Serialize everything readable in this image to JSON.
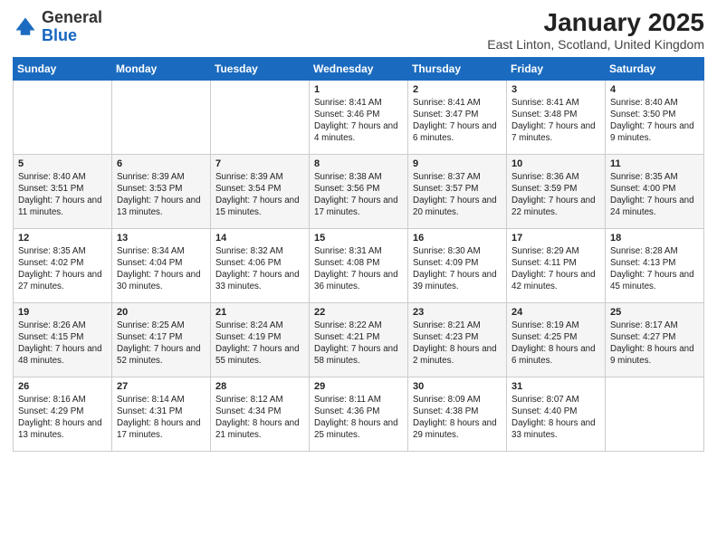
{
  "header": {
    "logo_general": "General",
    "logo_blue": "Blue",
    "title": "January 2025",
    "subtitle": "East Linton, Scotland, United Kingdom"
  },
  "weekdays": [
    "Sunday",
    "Monday",
    "Tuesday",
    "Wednesday",
    "Thursday",
    "Friday",
    "Saturday"
  ],
  "weeks": [
    [
      {
        "day": "",
        "info": ""
      },
      {
        "day": "",
        "info": ""
      },
      {
        "day": "",
        "info": ""
      },
      {
        "day": "1",
        "info": "Sunrise: 8:41 AM\nSunset: 3:46 PM\nDaylight: 7 hours\nand 4 minutes."
      },
      {
        "day": "2",
        "info": "Sunrise: 8:41 AM\nSunset: 3:47 PM\nDaylight: 7 hours\nand 6 minutes."
      },
      {
        "day": "3",
        "info": "Sunrise: 8:41 AM\nSunset: 3:48 PM\nDaylight: 7 hours\nand 7 minutes."
      },
      {
        "day": "4",
        "info": "Sunrise: 8:40 AM\nSunset: 3:50 PM\nDaylight: 7 hours\nand 9 minutes."
      }
    ],
    [
      {
        "day": "5",
        "info": "Sunrise: 8:40 AM\nSunset: 3:51 PM\nDaylight: 7 hours\nand 11 minutes."
      },
      {
        "day": "6",
        "info": "Sunrise: 8:39 AM\nSunset: 3:53 PM\nDaylight: 7 hours\nand 13 minutes."
      },
      {
        "day": "7",
        "info": "Sunrise: 8:39 AM\nSunset: 3:54 PM\nDaylight: 7 hours\nand 15 minutes."
      },
      {
        "day": "8",
        "info": "Sunrise: 8:38 AM\nSunset: 3:56 PM\nDaylight: 7 hours\nand 17 minutes."
      },
      {
        "day": "9",
        "info": "Sunrise: 8:37 AM\nSunset: 3:57 PM\nDaylight: 7 hours\nand 20 minutes."
      },
      {
        "day": "10",
        "info": "Sunrise: 8:36 AM\nSunset: 3:59 PM\nDaylight: 7 hours\nand 22 minutes."
      },
      {
        "day": "11",
        "info": "Sunrise: 8:35 AM\nSunset: 4:00 PM\nDaylight: 7 hours\nand 24 minutes."
      }
    ],
    [
      {
        "day": "12",
        "info": "Sunrise: 8:35 AM\nSunset: 4:02 PM\nDaylight: 7 hours\nand 27 minutes."
      },
      {
        "day": "13",
        "info": "Sunrise: 8:34 AM\nSunset: 4:04 PM\nDaylight: 7 hours\nand 30 minutes."
      },
      {
        "day": "14",
        "info": "Sunrise: 8:32 AM\nSunset: 4:06 PM\nDaylight: 7 hours\nand 33 minutes."
      },
      {
        "day": "15",
        "info": "Sunrise: 8:31 AM\nSunset: 4:08 PM\nDaylight: 7 hours\nand 36 minutes."
      },
      {
        "day": "16",
        "info": "Sunrise: 8:30 AM\nSunset: 4:09 PM\nDaylight: 7 hours\nand 39 minutes."
      },
      {
        "day": "17",
        "info": "Sunrise: 8:29 AM\nSunset: 4:11 PM\nDaylight: 7 hours\nand 42 minutes."
      },
      {
        "day": "18",
        "info": "Sunrise: 8:28 AM\nSunset: 4:13 PM\nDaylight: 7 hours\nand 45 minutes."
      }
    ],
    [
      {
        "day": "19",
        "info": "Sunrise: 8:26 AM\nSunset: 4:15 PM\nDaylight: 7 hours\nand 48 minutes."
      },
      {
        "day": "20",
        "info": "Sunrise: 8:25 AM\nSunset: 4:17 PM\nDaylight: 7 hours\nand 52 minutes."
      },
      {
        "day": "21",
        "info": "Sunrise: 8:24 AM\nSunset: 4:19 PM\nDaylight: 7 hours\nand 55 minutes."
      },
      {
        "day": "22",
        "info": "Sunrise: 8:22 AM\nSunset: 4:21 PM\nDaylight: 7 hours\nand 58 minutes."
      },
      {
        "day": "23",
        "info": "Sunrise: 8:21 AM\nSunset: 4:23 PM\nDaylight: 8 hours\nand 2 minutes."
      },
      {
        "day": "24",
        "info": "Sunrise: 8:19 AM\nSunset: 4:25 PM\nDaylight: 8 hours\nand 6 minutes."
      },
      {
        "day": "25",
        "info": "Sunrise: 8:17 AM\nSunset: 4:27 PM\nDaylight: 8 hours\nand 9 minutes."
      }
    ],
    [
      {
        "day": "26",
        "info": "Sunrise: 8:16 AM\nSunset: 4:29 PM\nDaylight: 8 hours\nand 13 minutes."
      },
      {
        "day": "27",
        "info": "Sunrise: 8:14 AM\nSunset: 4:31 PM\nDaylight: 8 hours\nand 17 minutes."
      },
      {
        "day": "28",
        "info": "Sunrise: 8:12 AM\nSunset: 4:34 PM\nDaylight: 8 hours\nand 21 minutes."
      },
      {
        "day": "29",
        "info": "Sunrise: 8:11 AM\nSunset: 4:36 PM\nDaylight: 8 hours\nand 25 minutes."
      },
      {
        "day": "30",
        "info": "Sunrise: 8:09 AM\nSunset: 4:38 PM\nDaylight: 8 hours\nand 29 minutes."
      },
      {
        "day": "31",
        "info": "Sunrise: 8:07 AM\nSunset: 4:40 PM\nDaylight: 8 hours\nand 33 minutes."
      },
      {
        "day": "",
        "info": ""
      }
    ]
  ]
}
